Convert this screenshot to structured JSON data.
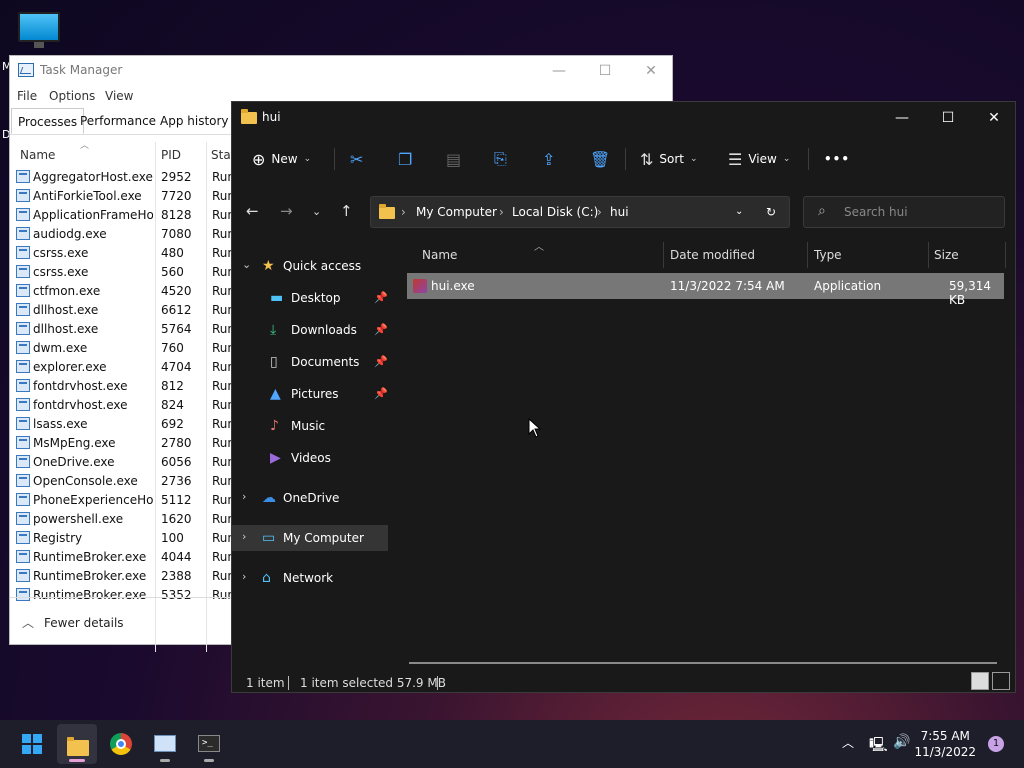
{
  "desktop": {
    "icon_label": "M",
    "icon2_label": "D"
  },
  "task_manager": {
    "title": "Task Manager",
    "controls": {
      "minimize": "—",
      "maximize": "☐",
      "close": "✕"
    },
    "menu": [
      "File",
      "Options",
      "View"
    ],
    "tabs": [
      "Processes",
      "Performance",
      "App history"
    ],
    "columns": {
      "name": "Name",
      "pid": "PID",
      "status": "Stat"
    },
    "rows": [
      {
        "name": "AggregatorHost.exe",
        "pid": "2952",
        "status": "Run"
      },
      {
        "name": "AntiForkieTool.exe",
        "pid": "7720",
        "status": "Run"
      },
      {
        "name": "ApplicationFrameHo...",
        "pid": "8128",
        "status": "Run"
      },
      {
        "name": "audiodg.exe",
        "pid": "7080",
        "status": "Run"
      },
      {
        "name": "csrss.exe",
        "pid": "480",
        "status": "Run"
      },
      {
        "name": "csrss.exe",
        "pid": "560",
        "status": "Run"
      },
      {
        "name": "ctfmon.exe",
        "pid": "4520",
        "status": "Run"
      },
      {
        "name": "dllhost.exe",
        "pid": "6612",
        "status": "Run"
      },
      {
        "name": "dllhost.exe",
        "pid": "5764",
        "status": "Run"
      },
      {
        "name": "dwm.exe",
        "pid": "760",
        "status": "Run"
      },
      {
        "name": "explorer.exe",
        "pid": "4704",
        "status": "Run"
      },
      {
        "name": "fontdrvhost.exe",
        "pid": "812",
        "status": "Run"
      },
      {
        "name": "fontdrvhost.exe",
        "pid": "824",
        "status": "Run"
      },
      {
        "name": "lsass.exe",
        "pid": "692",
        "status": "Run"
      },
      {
        "name": "MsMpEng.exe",
        "pid": "2780",
        "status": "Run"
      },
      {
        "name": "OneDrive.exe",
        "pid": "6056",
        "status": "Run"
      },
      {
        "name": "OpenConsole.exe",
        "pid": "2736",
        "status": "Run"
      },
      {
        "name": "PhoneExperienceHo...",
        "pid": "5112",
        "status": "Run"
      },
      {
        "name": "powershell.exe",
        "pid": "1620",
        "status": "Run"
      },
      {
        "name": "Registry",
        "pid": "100",
        "status": "Run"
      },
      {
        "name": "RuntimeBroker.exe",
        "pid": "4044",
        "status": "Run"
      },
      {
        "name": "RuntimeBroker.exe",
        "pid": "2388",
        "status": "Run"
      },
      {
        "name": "RuntimeBroker.exe",
        "pid": "5352",
        "status": "Run"
      }
    ],
    "footer": "Fewer details"
  },
  "explorer": {
    "title": "hui",
    "toolbar": {
      "new": "New",
      "sort": "Sort",
      "view": "View",
      "more": "•••"
    },
    "address": {
      "crumbs": [
        "My Computer",
        "Local Disk (C:)",
        "hui"
      ]
    },
    "search": {
      "placeholder": "Search hui"
    },
    "sidebar": [
      {
        "label": "Quick access",
        "icon": "star-icon"
      },
      {
        "label": "Desktop",
        "icon": "desktop-icon"
      },
      {
        "label": "Downloads",
        "icon": "download-icon"
      },
      {
        "label": "Documents",
        "icon": "document-icon"
      },
      {
        "label": "Pictures",
        "icon": "picture-icon"
      },
      {
        "label": "Music",
        "icon": "music-icon"
      },
      {
        "label": "Videos",
        "icon": "video-icon"
      },
      {
        "label": "OneDrive",
        "icon": "cloud-icon"
      },
      {
        "label": "My Computer",
        "icon": "computer-icon"
      },
      {
        "label": "Network",
        "icon": "network-icon"
      }
    ],
    "columns": {
      "name": "Name",
      "date": "Date modified",
      "type": "Type",
      "size": "Size"
    },
    "files": [
      {
        "name": "hui.exe",
        "date": "11/3/2022 7:54 AM",
        "type": "Application",
        "size": "59,314 KB"
      }
    ],
    "status": {
      "count": "1 item",
      "selected": "1 item selected  57.9 MB"
    }
  },
  "taskbar": {
    "time": "7:55 AM",
    "date": "11/3/2022",
    "notifications": "1"
  },
  "colors": {
    "accent": "#4fa6ff",
    "folder": "#f2c14e",
    "selected_row": "#777777"
  }
}
